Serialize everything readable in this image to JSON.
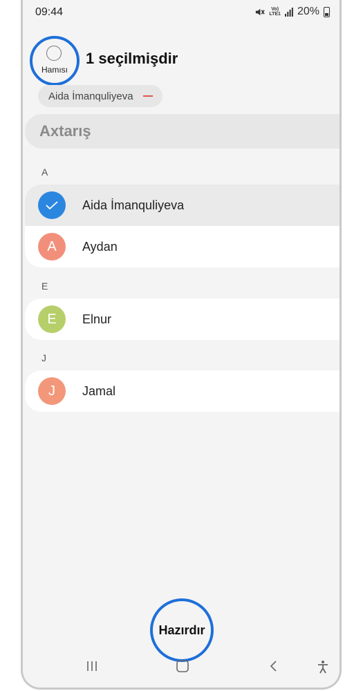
{
  "status_bar": {
    "time": "09:44",
    "network_top": "Vo)",
    "network_bottom": "LTE1",
    "battery": "20%"
  },
  "header": {
    "select_all_label": "Hamısı",
    "title": "1 seçilmişdir"
  },
  "selected_chip": {
    "name": "Aida İmanquliyeva"
  },
  "search": {
    "placeholder": "Axtarış"
  },
  "sections": [
    {
      "letter": "A",
      "contacts": [
        {
          "name": "Aida İmanquliyeva",
          "selected": true
        },
        {
          "name": "Aydan",
          "initial": "A",
          "color": "#f28f7a"
        }
      ]
    },
    {
      "letter": "E",
      "contacts": [
        {
          "name": "Elnur",
          "initial": "E",
          "color": "#b7cf6a"
        }
      ]
    },
    {
      "letter": "J",
      "contacts": [
        {
          "name": "Jamal",
          "initial": "J",
          "color": "#f2977a"
        }
      ]
    }
  ],
  "done_button": {
    "label": "Hazırdır"
  },
  "colors": {
    "accent": "#1e6fd9",
    "check_bg": "#2b86e0",
    "remove": "#e0554a"
  }
}
